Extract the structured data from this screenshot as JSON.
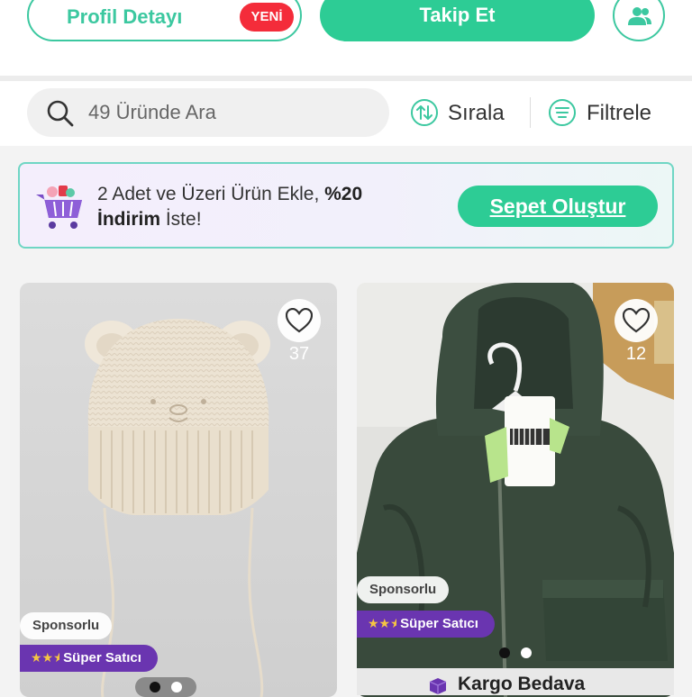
{
  "header": {
    "profile_button": "Profil Detayı",
    "new_badge": "YENİ",
    "follow_button": "Takip Et",
    "users_icon": "users-icon"
  },
  "toolbar": {
    "search_placeholder": "49 Üründe Ara",
    "sort_label": "Sırala",
    "filter_label": "Filtrele"
  },
  "promo": {
    "text_part1": "2 Adet ve Üzeri Ürün Ekle, ",
    "text_bold1": "%20",
    "text_bold2": "İndirim",
    "text_part2": " İste!",
    "cta": "Sepet Oluştur"
  },
  "products": [
    {
      "likes": "37",
      "sponsor": "Sponsorlu",
      "seller": "Süper Satıcı",
      "image": "knitted-bear-baby-hat",
      "active_dot": 0
    },
    {
      "likes": "12",
      "sponsor": "Sponsorlu",
      "seller": "Süper Satıcı",
      "image": "green-hooded-baby-jacket",
      "shipping": "Kargo Bedava",
      "active_dot": 1
    }
  ],
  "colors": {
    "accent": "#2dcc95",
    "badge_red": "#f42c3a",
    "seller_purple": "#6a35b0"
  }
}
